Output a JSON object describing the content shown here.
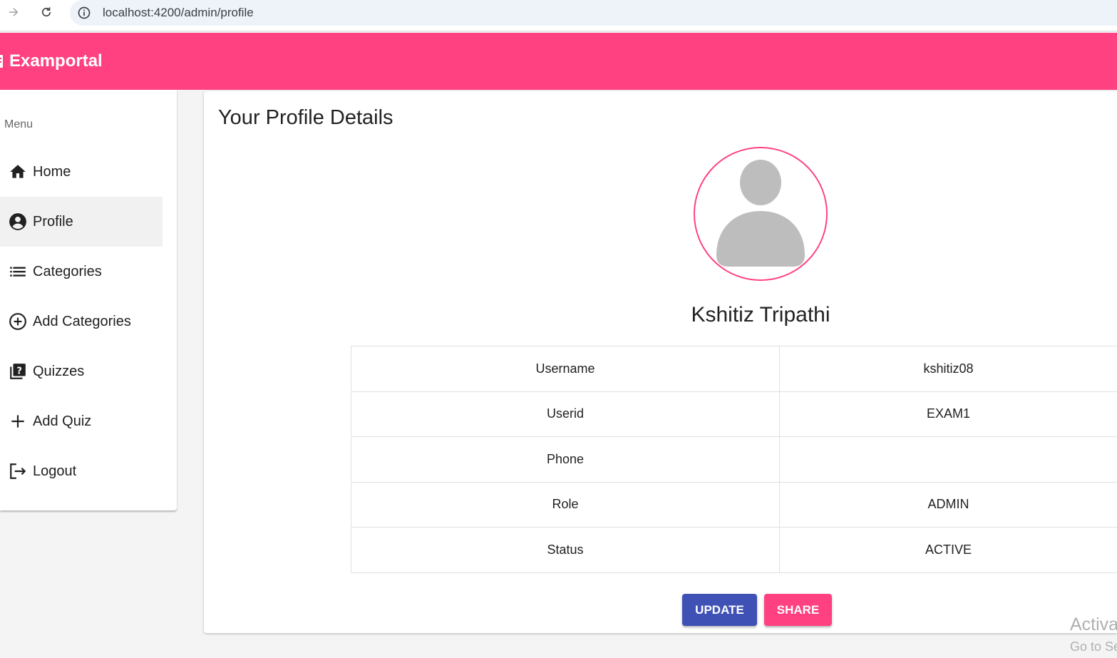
{
  "browser": {
    "url": "localhost:4200/admin/profile"
  },
  "toolbar": {
    "brand": "Examportal",
    "color": "#ff4081"
  },
  "sidebar": {
    "title": "Menu",
    "items": [
      {
        "label": "Home",
        "icon": "home-icon"
      },
      {
        "label": "Profile",
        "icon": "account-circle-icon",
        "active": true
      },
      {
        "label": "Categories",
        "icon": "list-icon"
      },
      {
        "label": "Add Categories",
        "icon": "add-circle-icon"
      },
      {
        "label": "Quizzes",
        "icon": "quiz-icon"
      },
      {
        "label": "Add Quiz",
        "icon": "plus-icon"
      },
      {
        "label": "Logout",
        "icon": "logout-icon"
      }
    ]
  },
  "profile": {
    "heading": "Your Profile Details",
    "name": "Kshitiz Tripathi",
    "rows": [
      {
        "key": "Username",
        "value": "kshitiz08"
      },
      {
        "key": "Userid",
        "value": "EXAM1"
      },
      {
        "key": "Phone",
        "value": ""
      },
      {
        "key": "Role",
        "value": "ADMIN"
      },
      {
        "key": "Status",
        "value": "ACTIVE"
      }
    ]
  },
  "actions": {
    "update_label": "UPDATE",
    "share_label": "SHARE",
    "update_color": "#3f51b5",
    "share_color": "#ff4081"
  },
  "watermark": {
    "line1": "Activa",
    "line2": "Go to Se"
  }
}
